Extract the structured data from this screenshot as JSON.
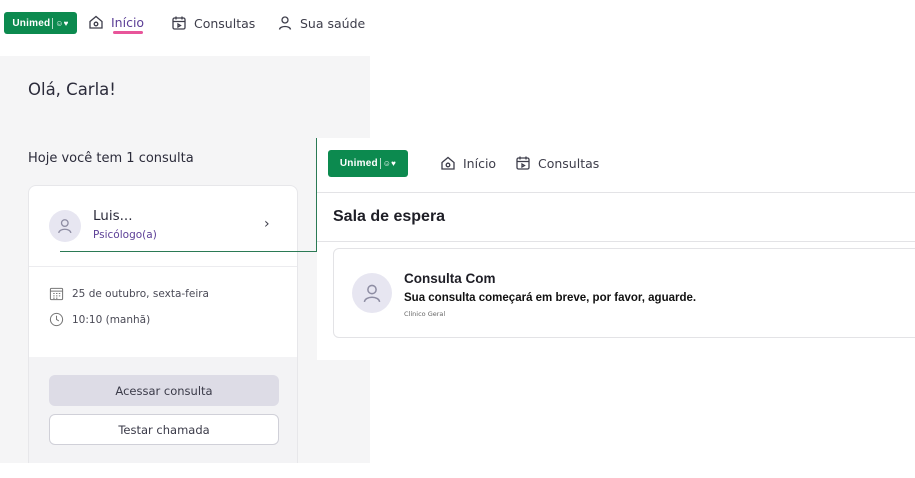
{
  "brand": {
    "logo_text": "Unimed",
    "logo_mark": "☺♥",
    "color": "#0c8a4f"
  },
  "main_nav": {
    "items": [
      {
        "label": "Início",
        "icon": "home-icon",
        "active": true
      },
      {
        "label": "Consultas",
        "icon": "calendar-icon",
        "active": false
      },
      {
        "label": "Sua saúde",
        "icon": "person-icon",
        "active": false
      }
    ],
    "active_color": "#e8559a"
  },
  "home": {
    "greeting": "Olá, Carla!",
    "today_summary": "Hoje você tem 1 consulta",
    "appointment": {
      "doctor_name": "Luis...",
      "specialty": "Psicólogo(a)",
      "date": "25 de outubro, sexta-feira",
      "time": "10:10 (manhã)",
      "access_label": "Acessar consulta",
      "test_label": "Testar chamada"
    }
  },
  "waiting_room": {
    "nav": [
      {
        "label": "Início",
        "icon": "home-icon"
      },
      {
        "label": "Consultas",
        "icon": "calendar-icon"
      }
    ],
    "title": "Sala de espera",
    "card": {
      "title": "Consulta Com",
      "message": "Sua consulta começará em breve, por favor, aguarde.",
      "specialty": "Clínico Geral"
    }
  }
}
